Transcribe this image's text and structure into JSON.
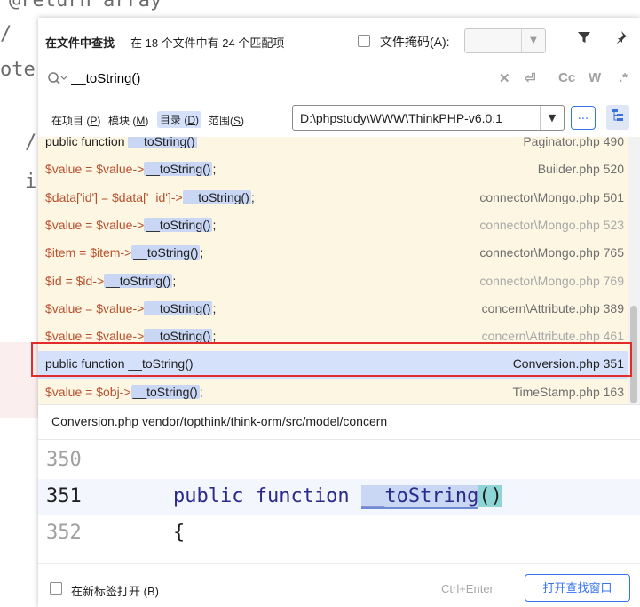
{
  "background_code": {
    "line1": "@return array",
    "line2": "/",
    "line3": "ote",
    "line4": "/",
    "line5": "i"
  },
  "header": {
    "title": "在文件中查找",
    "match_summary": "在 18 个文件中有 24 个匹配项",
    "file_mask_label": "文件掩码(A):",
    "file_mask_value": ""
  },
  "search": {
    "query": "__toString()",
    "options": [
      "Cc",
      "W",
      ".*"
    ]
  },
  "scope": {
    "items": [
      {
        "label": "在项目",
        "key": "P"
      },
      {
        "label": "模块",
        "key": "M"
      },
      {
        "label": "目录",
        "key": "D",
        "selected": true
      },
      {
        "label": "范围",
        "key": "S"
      }
    ],
    "directory": "D:\\phpstudy\\WWW\\ThinkPHP-v6.0.1",
    "browse_label": "..."
  },
  "results": [
    {
      "pre": "public function ",
      "match": "__toString()",
      "post": "",
      "file": "Paginator.php 490",
      "faint": false,
      "var_pre": false
    },
    {
      "pre": "$value = $value->",
      "match": "__toString()",
      "post": ";",
      "file": "Builder.php 520",
      "faint": false,
      "var_pre": true
    },
    {
      "pre": "$data['id'] = $data['_id']->",
      "match": "__toString()",
      "post": ";",
      "file": "connector\\Mongo.php 501",
      "faint": false,
      "var_pre": true
    },
    {
      "pre": "$value = $value->",
      "match": "__toString()",
      "post": ";",
      "file": "connector\\Mongo.php 523",
      "faint": true,
      "var_pre": true
    },
    {
      "pre": "$item = $item->",
      "match": "__toString()",
      "post": ";",
      "file": "connector\\Mongo.php 765",
      "faint": false,
      "var_pre": true
    },
    {
      "pre": "$id = $id->",
      "match": "__toString()",
      "post": ";",
      "file": "connector\\Mongo.php 769",
      "faint": true,
      "var_pre": true
    },
    {
      "pre": "$value = $value->",
      "match": "__toString()",
      "post": ";",
      "file": "concern\\Attribute.php 389",
      "faint": false,
      "var_pre": true
    },
    {
      "pre": "$value = $value->",
      "match": "__toString()",
      "post": ";",
      "file": "concern\\Attribute.php 461",
      "faint": true,
      "var_pre": true
    },
    {
      "pre": "public function __toString()",
      "match": "",
      "post": "",
      "file": "Conversion.php 351",
      "faint": false,
      "var_pre": false,
      "selected": true
    },
    {
      "pre": "$value = $obj->",
      "match": "__toString()",
      "post": ";",
      "file": "TimeStamp.php 163",
      "faint": false,
      "var_pre": true
    }
  ],
  "preview": {
    "path": "Conversion.php  vendor/topthink/think-orm/src/model/concern",
    "lines": [
      {
        "num": "350",
        "kw": "",
        "ident": "",
        "rest": ""
      },
      {
        "num": "351",
        "kw": "public function ",
        "ident": "__toString",
        "paren": "()",
        "rest": ""
      },
      {
        "num": "352",
        "kw": "",
        "ident": "",
        "rest": "{"
      }
    ]
  },
  "footer": {
    "open_in_tab": "在新标签打开 (B)",
    "shortcut": "Ctrl+Enter",
    "open_button": "打开查找窗口"
  },
  "colors": {
    "accent": "#3574f0",
    "selection": "#d5e1fb",
    "results_bg": "#fdf6e3",
    "highlight_frame": "#e22b2b"
  }
}
